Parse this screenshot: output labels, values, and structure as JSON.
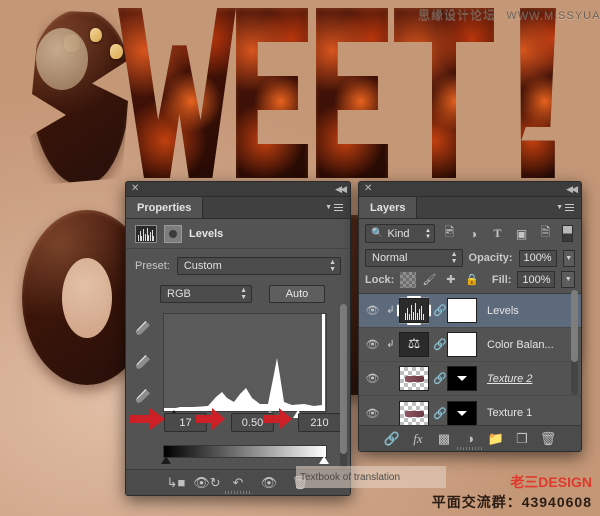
{
  "watermarks": {
    "top_cn": "思缘设计论坛",
    "top_url": "WWW.MISSYUAN.COM",
    "brand": "老三DESIGN",
    "qq_group": "平面交流群：43940608",
    "translate_overlay": "Textbook of translation"
  },
  "artwork": {
    "letters": [
      "S",
      "W",
      "E",
      "E",
      "T",
      "!"
    ],
    "description_alt": "chocolate SWEET lettering"
  },
  "properties_panel": {
    "titlebar": {
      "close": "✕",
      "collapse": "◀◀"
    },
    "tab_label": "Properties",
    "menu_icon": "panel-menu-icon",
    "adjustment_title": "Levels",
    "adjustment_icon": "levels-histogram-icon",
    "clip_icon": "clip-to-layer-icon",
    "preset_label": "Preset:",
    "preset_value": "Custom",
    "channel_value": "RGB",
    "auto_label": "Auto",
    "eyedroppers": [
      "set-black-point-eyedropper",
      "set-gray-point-eyedropper",
      "set-white-point-eyedropper"
    ],
    "input_shadow": "17",
    "input_midtone": "0.50",
    "input_highlight": "210",
    "footer_icons": [
      "clip-to-layer-icon",
      "view-previous-state-icon",
      "reset-adjustment-icon",
      "toggle-layer-visibility-icon",
      "delete-adjustment-icon"
    ]
  },
  "layers_panel": {
    "titlebar": {
      "close": "✕",
      "collapse": "◀◀"
    },
    "tab_label": "Layers",
    "menu_icon": "panel-menu-icon",
    "filter_kind": "Kind",
    "filter_icons": [
      "pixel-layer-filter-icon",
      "adjustment-layer-filter-icon",
      "type-layer-filter-icon",
      "shape-layer-filter-icon",
      "smart-object-filter-icon"
    ],
    "blend_mode": "Normal",
    "opacity_label": "Opacity:",
    "opacity_value": "100%",
    "lock_label": "Lock:",
    "lock_icons": [
      "lock-transparent-pixels-icon",
      "lock-image-pixels-icon",
      "lock-position-icon",
      "lock-all-icon"
    ],
    "fill_label": "Fill:",
    "fill_value": "100%",
    "rows": [
      {
        "name": "Levels",
        "type": "adjustment",
        "clipped": true,
        "selected": true,
        "mask": "white",
        "italic": false
      },
      {
        "name": "Color Balan...",
        "type": "adjustment",
        "clipped": true,
        "selected": false,
        "mask": "white",
        "italic": false
      },
      {
        "name": "Texture 2",
        "type": "pixel",
        "clipped": false,
        "selected": false,
        "mask": "black",
        "italic": true
      },
      {
        "name": "Texture 1",
        "type": "pixel",
        "clipped": false,
        "selected": false,
        "mask": "black",
        "italic": false
      }
    ],
    "footer_icons": [
      "link-layers-icon",
      "add-layer-style-icon",
      "add-layer-mask-icon",
      "new-adjustment-layer-icon",
      "new-group-icon",
      "new-layer-icon",
      "delete-layer-icon"
    ]
  },
  "colors": {
    "panel_bg": "#535353",
    "panel_tab_bg": "#404040",
    "selected_layer": "#5c6a7c",
    "annotation_red": "#cc2026",
    "brand_red": "#e0392b",
    "canvas_bg": "#d2a98d"
  }
}
